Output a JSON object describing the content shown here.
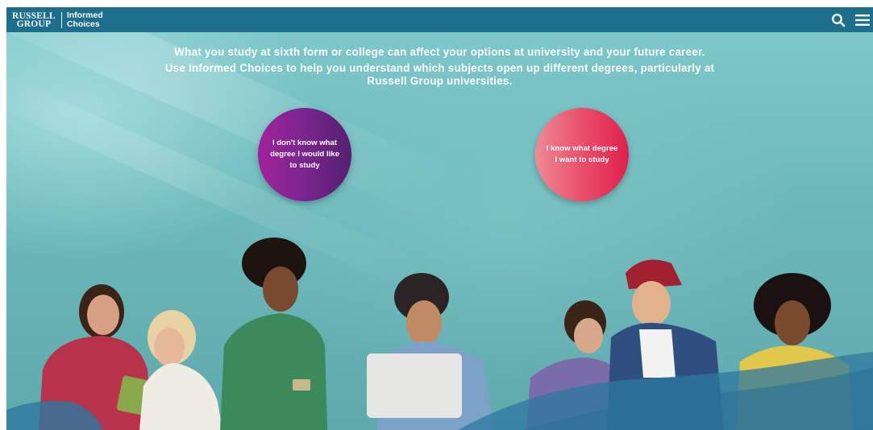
{
  "header": {
    "logo_line1": "RUSSELL",
    "logo_line2": "GROUP",
    "product_line1": "Informed",
    "product_line2": "Choices",
    "search_icon": "search-icon",
    "menu_icon": "hamburger-menu-icon"
  },
  "intro": {
    "line1": "What you study at sixth form or college can affect your options at university and your future career.",
    "line2": "Use Informed Choices to help you understand which subjects open up different degrees, particularly at Russell Group universities."
  },
  "options": {
    "unknown_degree": "I don't know what degree I would like to study",
    "known_degree": "I know what degree I want to study"
  },
  "colors": {
    "header_bg": "#1d6e8c",
    "background": "#6cb9bb",
    "circle_purple": "#7d2590",
    "circle_pink": "#ea4f6a"
  }
}
